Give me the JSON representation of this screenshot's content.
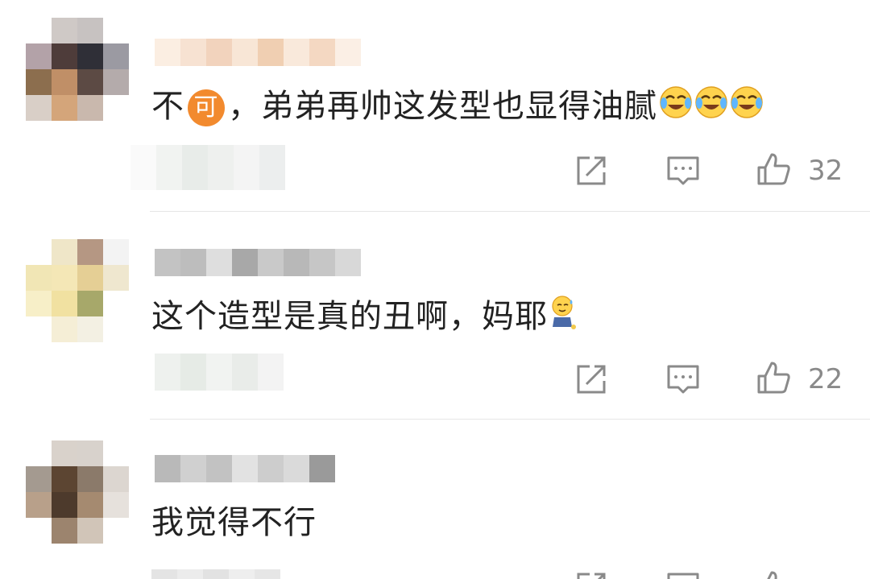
{
  "comments": [
    {
      "prefix": "不",
      "badge": "可",
      "text": "，弟弟再帅这发型也显得油腻",
      "emoji": [
        "laughing-crying-emoji",
        "laughing-crying-emoji",
        "laughing-crying-emoji"
      ],
      "like_count": "32"
    },
    {
      "text": "这个造型是真的丑啊，妈耶",
      "emoji": [
        "sweating-sitting-emoji"
      ],
      "like_count": "22"
    },
    {
      "text": "我觉得不行"
    }
  ],
  "icons": {
    "share": "share-icon",
    "comment": "comment-icon",
    "like": "thumbs-up-icon"
  },
  "colors": {
    "badge": "#f28a2e",
    "text": "#222222",
    "meta": "#8a8a8a",
    "divider": "#e6e6e6"
  }
}
